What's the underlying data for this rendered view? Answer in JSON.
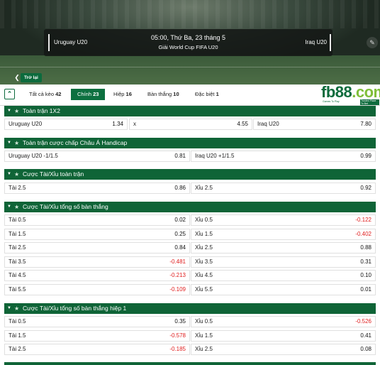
{
  "match": {
    "home_team": "Uruguay U20",
    "away_team": "Iraq U20",
    "datetime": "05:00, Thứ Ba, 23 tháng 5",
    "league": "Giải World Cup FIFA U20",
    "back_label": "Trở lại"
  },
  "tabs": [
    {
      "label": "Tất cả kèo",
      "count": "42"
    },
    {
      "label": "Chính",
      "count": "23"
    },
    {
      "label": "Hiệp",
      "count": "16"
    },
    {
      "label": "Bàn thắng",
      "count": "10"
    },
    {
      "label": "Đặc biệt",
      "count": "1"
    }
  ],
  "logo": {
    "text": "fb88",
    "dot": ".com",
    "tagline": "Games To Play",
    "badge": "Trusted Place To Bet"
  },
  "sections": [
    {
      "title": "Toàn trận 1X2",
      "rows": [
        [
          {
            "label": "Uruguay U20",
            "odd": "1.34"
          },
          {
            "label": "x",
            "odd": "4.55"
          },
          {
            "label": "Iraq U20",
            "odd": "7.80"
          }
        ]
      ]
    },
    {
      "title": "Toàn trận cược chấp Châu Á Handicap",
      "rows": [
        [
          {
            "label": "Uruguay U20",
            "line": "-1/1.5",
            "odd": "0.81"
          },
          {
            "label": "Iraq U20",
            "line": "+1/1.5",
            "odd": "0.99"
          }
        ]
      ]
    },
    {
      "title": "Cược Tài/Xỉu toàn trận",
      "rows": [
        [
          {
            "label": "Tài",
            "line": "2.5",
            "odd": "0.86"
          },
          {
            "label": "Xỉu",
            "line": "2.5",
            "odd": "0.92"
          }
        ]
      ]
    },
    {
      "title": "Cược Tài/Xỉu tổng số bàn thắng",
      "rows": [
        [
          {
            "label": "Tài",
            "line": "0.5",
            "odd": "0.02"
          },
          {
            "label": "Xỉu",
            "line": "0.5",
            "odd": "-0.122"
          }
        ],
        [
          {
            "label": "Tài",
            "line": "1.5",
            "odd": "0.25"
          },
          {
            "label": "Xỉu",
            "line": "1.5",
            "odd": "-0.402"
          }
        ],
        [
          {
            "label": "Tài",
            "line": "2.5",
            "odd": "0.84"
          },
          {
            "label": "Xỉu",
            "line": "2.5",
            "odd": "0.88"
          }
        ],
        [
          {
            "label": "Tài",
            "line": "3.5",
            "odd": "-0.481"
          },
          {
            "label": "Xỉu",
            "line": "3.5",
            "odd": "0.31"
          }
        ],
        [
          {
            "label": "Tài",
            "line": "4.5",
            "odd": "-0.213"
          },
          {
            "label": "Xỉu",
            "line": "4.5",
            "odd": "0.10"
          }
        ],
        [
          {
            "label": "Tài",
            "line": "5.5",
            "odd": "-0.109"
          },
          {
            "label": "Xỉu",
            "line": "5.5",
            "odd": "0.01"
          }
        ]
      ]
    },
    {
      "title": "Cược Tài/Xỉu tổng số bàn thắng hiệp 1",
      "rows": [
        [
          {
            "label": "Tài",
            "line": "0.5",
            "odd": "0.35"
          },
          {
            "label": "Xỉu",
            "line": "0.5",
            "odd": "-0.526"
          }
        ],
        [
          {
            "label": "Tài",
            "line": "1.5",
            "odd": "-0.578"
          },
          {
            "label": "Xỉu",
            "line": "1.5",
            "odd": "0.41"
          }
        ],
        [
          {
            "label": "Tài",
            "line": "2.5",
            "odd": "-0.185"
          },
          {
            "label": "Xỉu",
            "line": "2.5",
            "odd": "0.08"
          }
        ]
      ]
    }
  ],
  "colors": {
    "header_green": "#0f6437",
    "active_tab": "#0d7040",
    "negative_odd": "#e02020"
  }
}
